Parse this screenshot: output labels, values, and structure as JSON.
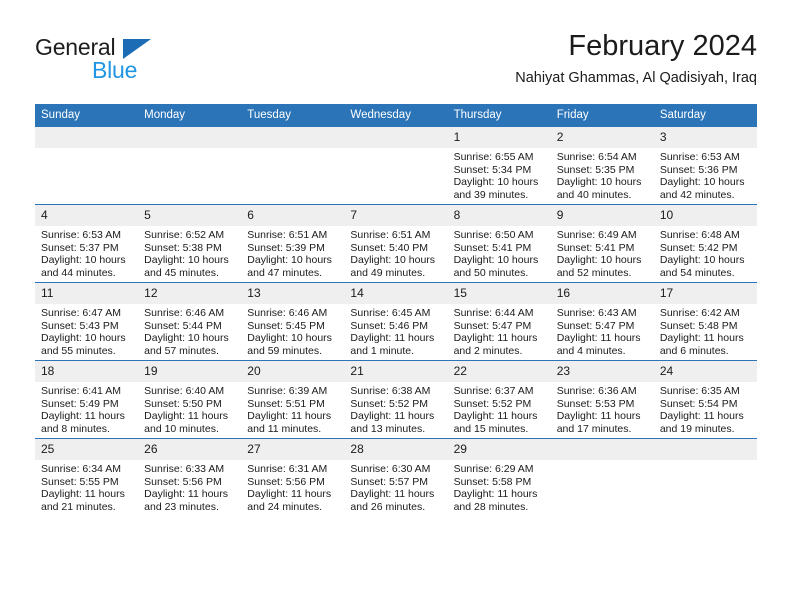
{
  "brand": {
    "name_top": "General",
    "name_bottom": "Blue",
    "triangle_color": "#1b6bb5",
    "blue_text_color": "#2196e3"
  },
  "header": {
    "title": "February 2024",
    "subtitle": "Nahiyat Ghammas, Al Qadisiyah, Iraq"
  },
  "theme": {
    "header_blue": "#2b74b8",
    "daynum_gray": "#efefef",
    "text": "#1b1b1b"
  },
  "calendar": {
    "weekday_headers": [
      "Sunday",
      "Monday",
      "Tuesday",
      "Wednesday",
      "Thursday",
      "Friday",
      "Saturday"
    ],
    "weeks": [
      [
        {
          "day": "",
          "sunrise": "",
          "sunset": "",
          "daylight_1": "",
          "daylight_2": ""
        },
        {
          "day": "",
          "sunrise": "",
          "sunset": "",
          "daylight_1": "",
          "daylight_2": ""
        },
        {
          "day": "",
          "sunrise": "",
          "sunset": "",
          "daylight_1": "",
          "daylight_2": ""
        },
        {
          "day": "",
          "sunrise": "",
          "sunset": "",
          "daylight_1": "",
          "daylight_2": ""
        },
        {
          "day": "1",
          "sunrise": "Sunrise: 6:55 AM",
          "sunset": "Sunset: 5:34 PM",
          "daylight_1": "Daylight: 10 hours",
          "daylight_2": "and 39 minutes."
        },
        {
          "day": "2",
          "sunrise": "Sunrise: 6:54 AM",
          "sunset": "Sunset: 5:35 PM",
          "daylight_1": "Daylight: 10 hours",
          "daylight_2": "and 40 minutes."
        },
        {
          "day": "3",
          "sunrise": "Sunrise: 6:53 AM",
          "sunset": "Sunset: 5:36 PM",
          "daylight_1": "Daylight: 10 hours",
          "daylight_2": "and 42 minutes."
        }
      ],
      [
        {
          "day": "4",
          "sunrise": "Sunrise: 6:53 AM",
          "sunset": "Sunset: 5:37 PM",
          "daylight_1": "Daylight: 10 hours",
          "daylight_2": "and 44 minutes."
        },
        {
          "day": "5",
          "sunrise": "Sunrise: 6:52 AM",
          "sunset": "Sunset: 5:38 PM",
          "daylight_1": "Daylight: 10 hours",
          "daylight_2": "and 45 minutes."
        },
        {
          "day": "6",
          "sunrise": "Sunrise: 6:51 AM",
          "sunset": "Sunset: 5:39 PM",
          "daylight_1": "Daylight: 10 hours",
          "daylight_2": "and 47 minutes."
        },
        {
          "day": "7",
          "sunrise": "Sunrise: 6:51 AM",
          "sunset": "Sunset: 5:40 PM",
          "daylight_1": "Daylight: 10 hours",
          "daylight_2": "and 49 minutes."
        },
        {
          "day": "8",
          "sunrise": "Sunrise: 6:50 AM",
          "sunset": "Sunset: 5:41 PM",
          "daylight_1": "Daylight: 10 hours",
          "daylight_2": "and 50 minutes."
        },
        {
          "day": "9",
          "sunrise": "Sunrise: 6:49 AM",
          "sunset": "Sunset: 5:41 PM",
          "daylight_1": "Daylight: 10 hours",
          "daylight_2": "and 52 minutes."
        },
        {
          "day": "10",
          "sunrise": "Sunrise: 6:48 AM",
          "sunset": "Sunset: 5:42 PM",
          "daylight_1": "Daylight: 10 hours",
          "daylight_2": "and 54 minutes."
        }
      ],
      [
        {
          "day": "11",
          "sunrise": "Sunrise: 6:47 AM",
          "sunset": "Sunset: 5:43 PM",
          "daylight_1": "Daylight: 10 hours",
          "daylight_2": "and 55 minutes."
        },
        {
          "day": "12",
          "sunrise": "Sunrise: 6:46 AM",
          "sunset": "Sunset: 5:44 PM",
          "daylight_1": "Daylight: 10 hours",
          "daylight_2": "and 57 minutes."
        },
        {
          "day": "13",
          "sunrise": "Sunrise: 6:46 AM",
          "sunset": "Sunset: 5:45 PM",
          "daylight_1": "Daylight: 10 hours",
          "daylight_2": "and 59 minutes."
        },
        {
          "day": "14",
          "sunrise": "Sunrise: 6:45 AM",
          "sunset": "Sunset: 5:46 PM",
          "daylight_1": "Daylight: 11 hours",
          "daylight_2": "and 1 minute."
        },
        {
          "day": "15",
          "sunrise": "Sunrise: 6:44 AM",
          "sunset": "Sunset: 5:47 PM",
          "daylight_1": "Daylight: 11 hours",
          "daylight_2": "and 2 minutes."
        },
        {
          "day": "16",
          "sunrise": "Sunrise: 6:43 AM",
          "sunset": "Sunset: 5:47 PM",
          "daylight_1": "Daylight: 11 hours",
          "daylight_2": "and 4 minutes."
        },
        {
          "day": "17",
          "sunrise": "Sunrise: 6:42 AM",
          "sunset": "Sunset: 5:48 PM",
          "daylight_1": "Daylight: 11 hours",
          "daylight_2": "and 6 minutes."
        }
      ],
      [
        {
          "day": "18",
          "sunrise": "Sunrise: 6:41 AM",
          "sunset": "Sunset: 5:49 PM",
          "daylight_1": "Daylight: 11 hours",
          "daylight_2": "and 8 minutes."
        },
        {
          "day": "19",
          "sunrise": "Sunrise: 6:40 AM",
          "sunset": "Sunset: 5:50 PM",
          "daylight_1": "Daylight: 11 hours",
          "daylight_2": "and 10 minutes."
        },
        {
          "day": "20",
          "sunrise": "Sunrise: 6:39 AM",
          "sunset": "Sunset: 5:51 PM",
          "daylight_1": "Daylight: 11 hours",
          "daylight_2": "and 11 minutes."
        },
        {
          "day": "21",
          "sunrise": "Sunrise: 6:38 AM",
          "sunset": "Sunset: 5:52 PM",
          "daylight_1": "Daylight: 11 hours",
          "daylight_2": "and 13 minutes."
        },
        {
          "day": "22",
          "sunrise": "Sunrise: 6:37 AM",
          "sunset": "Sunset: 5:52 PM",
          "daylight_1": "Daylight: 11 hours",
          "daylight_2": "and 15 minutes."
        },
        {
          "day": "23",
          "sunrise": "Sunrise: 6:36 AM",
          "sunset": "Sunset: 5:53 PM",
          "daylight_1": "Daylight: 11 hours",
          "daylight_2": "and 17 minutes."
        },
        {
          "day": "24",
          "sunrise": "Sunrise: 6:35 AM",
          "sunset": "Sunset: 5:54 PM",
          "daylight_1": "Daylight: 11 hours",
          "daylight_2": "and 19 minutes."
        }
      ],
      [
        {
          "day": "25",
          "sunrise": "Sunrise: 6:34 AM",
          "sunset": "Sunset: 5:55 PM",
          "daylight_1": "Daylight: 11 hours",
          "daylight_2": "and 21 minutes."
        },
        {
          "day": "26",
          "sunrise": "Sunrise: 6:33 AM",
          "sunset": "Sunset: 5:56 PM",
          "daylight_1": "Daylight: 11 hours",
          "daylight_2": "and 23 minutes."
        },
        {
          "day": "27",
          "sunrise": "Sunrise: 6:31 AM",
          "sunset": "Sunset: 5:56 PM",
          "daylight_1": "Daylight: 11 hours",
          "daylight_2": "and 24 minutes."
        },
        {
          "day": "28",
          "sunrise": "Sunrise: 6:30 AM",
          "sunset": "Sunset: 5:57 PM",
          "daylight_1": "Daylight: 11 hours",
          "daylight_2": "and 26 minutes."
        },
        {
          "day": "29",
          "sunrise": "Sunrise: 6:29 AM",
          "sunset": "Sunset: 5:58 PM",
          "daylight_1": "Daylight: 11 hours",
          "daylight_2": "and 28 minutes."
        },
        {
          "day": "",
          "sunrise": "",
          "sunset": "",
          "daylight_1": "",
          "daylight_2": ""
        },
        {
          "day": "",
          "sunrise": "",
          "sunset": "",
          "daylight_1": "",
          "daylight_2": ""
        }
      ]
    ]
  }
}
